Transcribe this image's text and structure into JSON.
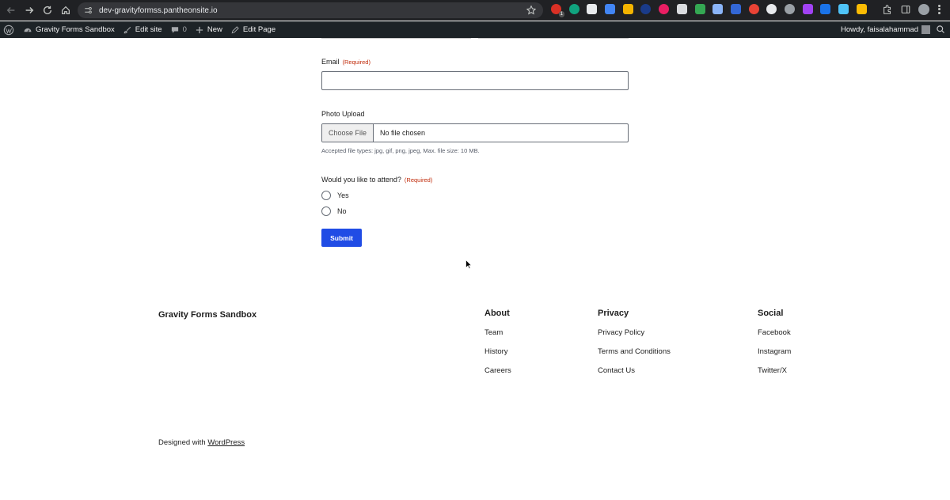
{
  "browser": {
    "url": "dev-gravityformss.pantheonsite.io",
    "extension_badge": "1"
  },
  "admin_bar": {
    "site_name": "Gravity Forms Sandbox",
    "edit_site": "Edit site",
    "comments_count": "0",
    "new_label": "New",
    "edit_page": "Edit Page",
    "howdy": "Howdy, faisalahammad"
  },
  "form": {
    "email_label": "Email",
    "email_required": "(Required)",
    "email_value": "",
    "photo_label": "Photo Upload",
    "choose_file": "Choose File",
    "file_status": "No file chosen",
    "file_description": "Accepted file types: jpg, gif, png, jpeg, Max. file size: 10 MB.",
    "attend_label": "Would you like to attend?",
    "attend_required": "(Required)",
    "options": [
      {
        "label": "Yes"
      },
      {
        "label": "No"
      }
    ],
    "submit_label": "Submit"
  },
  "footer": {
    "site_title": "Gravity Forms Sandbox",
    "columns": [
      {
        "heading": "About",
        "links": [
          "Team",
          "History",
          "Careers"
        ]
      },
      {
        "heading": "Privacy",
        "links": [
          "Privacy Policy",
          "Terms and Conditions",
          "Contact Us"
        ]
      },
      {
        "heading": "Social",
        "links": [
          "Facebook",
          "Instagram",
          "Twitter/X"
        ]
      }
    ],
    "credit_prefix": "Designed with",
    "credit_link": "WordPress"
  },
  "colors": {
    "primary_button": "#204ce5",
    "required_text": "#c02b0a",
    "admin_bar": "#1d2327",
    "browser_chrome": "#202124"
  }
}
